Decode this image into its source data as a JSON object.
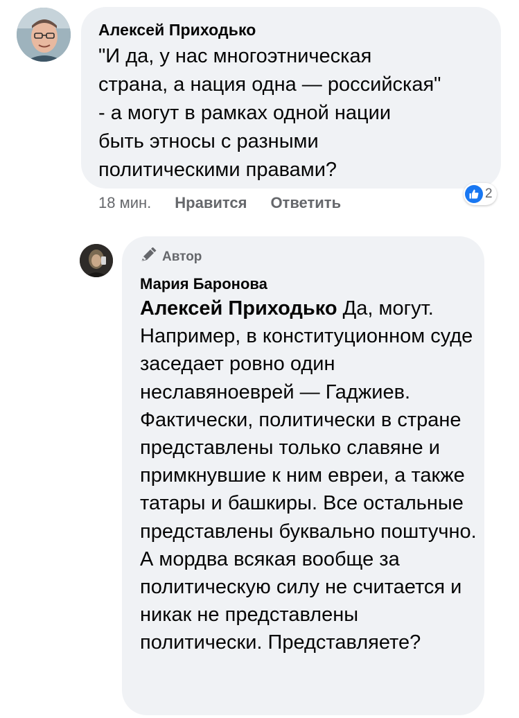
{
  "comment": {
    "author": "Алексей Приходько",
    "text": "\"И да, у нас многоэтническая\nстрана, а нация одна — российская\"\n- а могут в рамках одной нации\nбыть этносы с разными\nполитическими правами?",
    "time": "18 мин.",
    "like_label": "Нравится",
    "reply_label": "Ответить",
    "reactions": {
      "icon": "like-icon",
      "count": "2",
      "color": "#1877f2"
    }
  },
  "reply": {
    "badge_label": "Автор",
    "badge_icon": "pen-icon",
    "author": "Мария Баронова",
    "mention": "Алексей Приходько",
    "text": "Да, могут. Например, в конституционном суде заседает ровно один неславяноеврей — Гаджиев. Фактически, политически в стране представлены только славяне и примкнувшие к ним евреи, а также татары и башкиры. Все остальные представлены буквально поштучно. А мордва всякая вообще за политическую силу не считается и никак не представлены политически. Представляете?"
  },
  "colors": {
    "bubble": "#f0f2f5",
    "meta_text": "#65676b",
    "text": "#050505"
  }
}
